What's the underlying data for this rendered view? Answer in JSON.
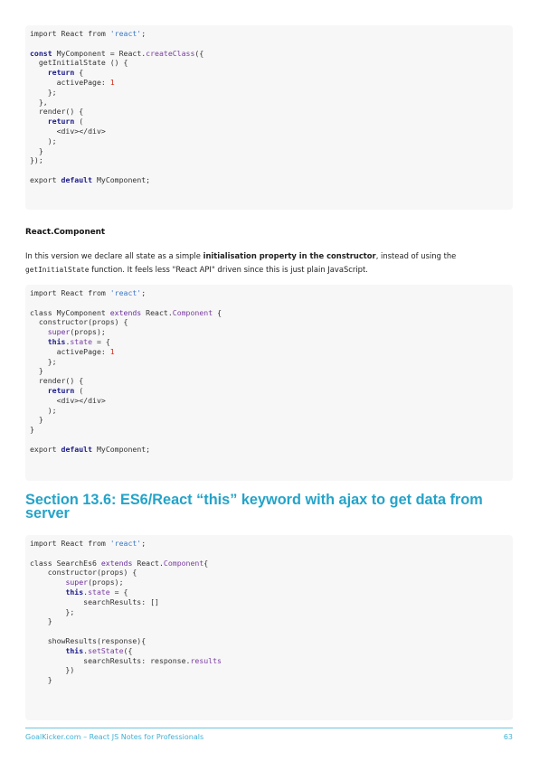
{
  "code_block_1": [
    [
      [
        "n",
        "import React from "
      ],
      [
        "s",
        "'react'"
      ],
      [
        "n",
        ";"
      ]
    ],
    [],
    [
      [
        "k",
        "const"
      ],
      [
        "n",
        " MyComponent = React."
      ],
      [
        "f",
        "createClass"
      ],
      [
        "n",
        "({"
      ]
    ],
    [
      [
        "n",
        "  getInitialState () {"
      ]
    ],
    [
      [
        "n",
        "    "
      ],
      [
        "k",
        "return"
      ],
      [
        "n",
        " {"
      ]
    ],
    [
      [
        "n",
        "      activePage: "
      ],
      [
        "d",
        "1"
      ]
    ],
    [
      [
        "n",
        "    };"
      ]
    ],
    [
      [
        "n",
        "  },"
      ]
    ],
    [
      [
        "n",
        "  render() {"
      ]
    ],
    [
      [
        "n",
        "    "
      ],
      [
        "k",
        "return"
      ],
      [
        "n",
        " ("
      ]
    ],
    [
      [
        "n",
        "      <div></div>"
      ]
    ],
    [
      [
        "n",
        "    );"
      ]
    ],
    [
      [
        "n",
        "  }"
      ]
    ],
    [
      [
        "n",
        "});"
      ]
    ],
    [],
    [
      [
        "n",
        "export "
      ],
      [
        "k",
        "default"
      ],
      [
        "n",
        " MyComponent;"
      ]
    ]
  ],
  "subheading": "React.Component",
  "paragraph": {
    "part1": "In this version we declare all state as a simple ",
    "bold": "initialisation property in the constructor",
    "part2": ", instead of using the",
    "code": "getInitialState",
    "part3": " function. It feels less \"React API\" driven since this is just plain JavaScript."
  },
  "code_block_2": [
    [
      [
        "n",
        "import React from "
      ],
      [
        "s",
        "'react'"
      ],
      [
        "n",
        ";"
      ]
    ],
    [],
    [
      [
        "n",
        "class MyComponent "
      ],
      [
        "p",
        "extends"
      ],
      [
        "n",
        " React."
      ],
      [
        "f",
        "Component"
      ],
      [
        "n",
        " {"
      ]
    ],
    [
      [
        "n",
        "  constructor(props) {"
      ]
    ],
    [
      [
        "n",
        "    "
      ],
      [
        "p",
        "super"
      ],
      [
        "n",
        "(props);"
      ]
    ],
    [
      [
        "n",
        "    "
      ],
      [
        "k",
        "this"
      ],
      [
        "n",
        "."
      ],
      [
        "f",
        "state"
      ],
      [
        "n",
        " = {"
      ]
    ],
    [
      [
        "n",
        "      activePage: "
      ],
      [
        "d",
        "1"
      ]
    ],
    [
      [
        "n",
        "    };"
      ]
    ],
    [
      [
        "n",
        "  }"
      ]
    ],
    [
      [
        "n",
        "  render() {"
      ]
    ],
    [
      [
        "n",
        "    "
      ],
      [
        "k",
        "return"
      ],
      [
        "n",
        " ("
      ]
    ],
    [
      [
        "n",
        "      <div></div>"
      ]
    ],
    [
      [
        "n",
        "    );"
      ]
    ],
    [
      [
        "n",
        "  }"
      ]
    ],
    [
      [
        "n",
        "}"
      ]
    ],
    [],
    [
      [
        "n",
        "export "
      ],
      [
        "k",
        "default"
      ],
      [
        "n",
        " MyComponent;"
      ]
    ]
  ],
  "section_title": "Section 13.6: ES6/React “this” keyword with ajax to get data from server",
  "code_block_3": [
    [
      [
        "n",
        "import React from "
      ],
      [
        "s",
        "'react'"
      ],
      [
        "n",
        ";"
      ]
    ],
    [],
    [
      [
        "n",
        "class SearchEs6 "
      ],
      [
        "p",
        "extends"
      ],
      [
        "n",
        " React."
      ],
      [
        "f",
        "Component"
      ],
      [
        "n",
        "{"
      ]
    ],
    [
      [
        "n",
        "    constructor(props) {"
      ]
    ],
    [
      [
        "n",
        "        "
      ],
      [
        "p",
        "super"
      ],
      [
        "n",
        "(props);"
      ]
    ],
    [
      [
        "n",
        "        "
      ],
      [
        "k",
        "this"
      ],
      [
        "n",
        "."
      ],
      [
        "f",
        "state"
      ],
      [
        "n",
        " = {"
      ]
    ],
    [
      [
        "n",
        "            searchResults: []"
      ]
    ],
    [
      [
        "n",
        "        };"
      ]
    ],
    [
      [
        "n",
        "    }"
      ]
    ],
    [],
    [
      [
        "n",
        "    showResults(response){"
      ]
    ],
    [
      [
        "n",
        "        "
      ],
      [
        "k",
        "this"
      ],
      [
        "n",
        "."
      ],
      [
        "f",
        "setState"
      ],
      [
        "n",
        "({"
      ]
    ],
    [
      [
        "n",
        "            searchResults: response."
      ],
      [
        "f",
        "results"
      ]
    ],
    [
      [
        "n",
        "        })"
      ]
    ],
    [
      [
        "n",
        "    }"
      ]
    ]
  ],
  "footer": {
    "left": "GoalKicker.com – React JS Notes for Professionals",
    "page_number": "63"
  },
  "colors": {
    "accent": "#24a3c9",
    "keyword": "#1a1a8a",
    "string": "#3a78c8",
    "number": "#d03020",
    "function": "#7a3ea0",
    "code_bg": "#f7f7f7"
  }
}
